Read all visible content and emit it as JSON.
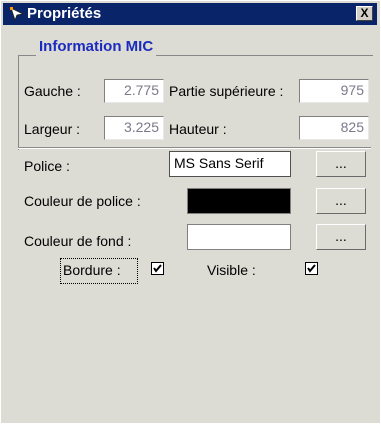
{
  "window": {
    "title": "Propriétés",
    "close_label": "X"
  },
  "group": {
    "title": "Information MIC"
  },
  "position": {
    "left_label": "Gauche :",
    "left_value": "2.775",
    "top_label": "Partie supérieure :",
    "top_value": "975",
    "width_label": "Largeur :",
    "width_value": "3.225",
    "height_label": "Hauteur :",
    "height_value": "825"
  },
  "appearance": {
    "font_label": "Police :",
    "font_value": "MS Sans Serif",
    "font_button": "...",
    "font_color_label": "Couleur de police :",
    "font_color": "#000000",
    "font_color_button": "...",
    "bg_color_label": "Couleur de fond :",
    "bg_color": "#ffffff",
    "bg_color_button": "...",
    "border_label": "Bordure :",
    "border_checked": true,
    "visible_label": "Visible :",
    "visible_checked": true
  },
  "colors": {
    "title_bar": "#0a246a",
    "group_title": "#1b2bbf",
    "panel": "#dcdcd4"
  },
  "icons": {
    "title": "properties-icon",
    "close": "close-icon",
    "checkbox": "checkmark-icon"
  }
}
